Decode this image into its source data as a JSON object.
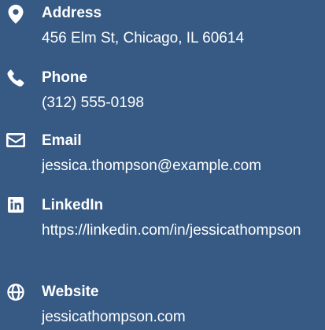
{
  "contact": {
    "background_color": "#365a84",
    "text_color": "#ffffff",
    "items": [
      {
        "icon": "map-marker-icon",
        "label": "Address",
        "value": "456 Elm St, Chicago, IL 60614"
      },
      {
        "icon": "phone-icon",
        "label": "Phone",
        "value": "(312) 555-0198"
      },
      {
        "icon": "envelope-icon",
        "label": "Email",
        "value": "jessica.thompson@example.com"
      },
      {
        "icon": "linkedin-icon",
        "label": "LinkedIn",
        "value": "https://linkedin.com/in/jessicathompson"
      },
      {
        "icon": "globe-icon",
        "label": "Website",
        "value": "jessicathompson.com"
      }
    ]
  }
}
